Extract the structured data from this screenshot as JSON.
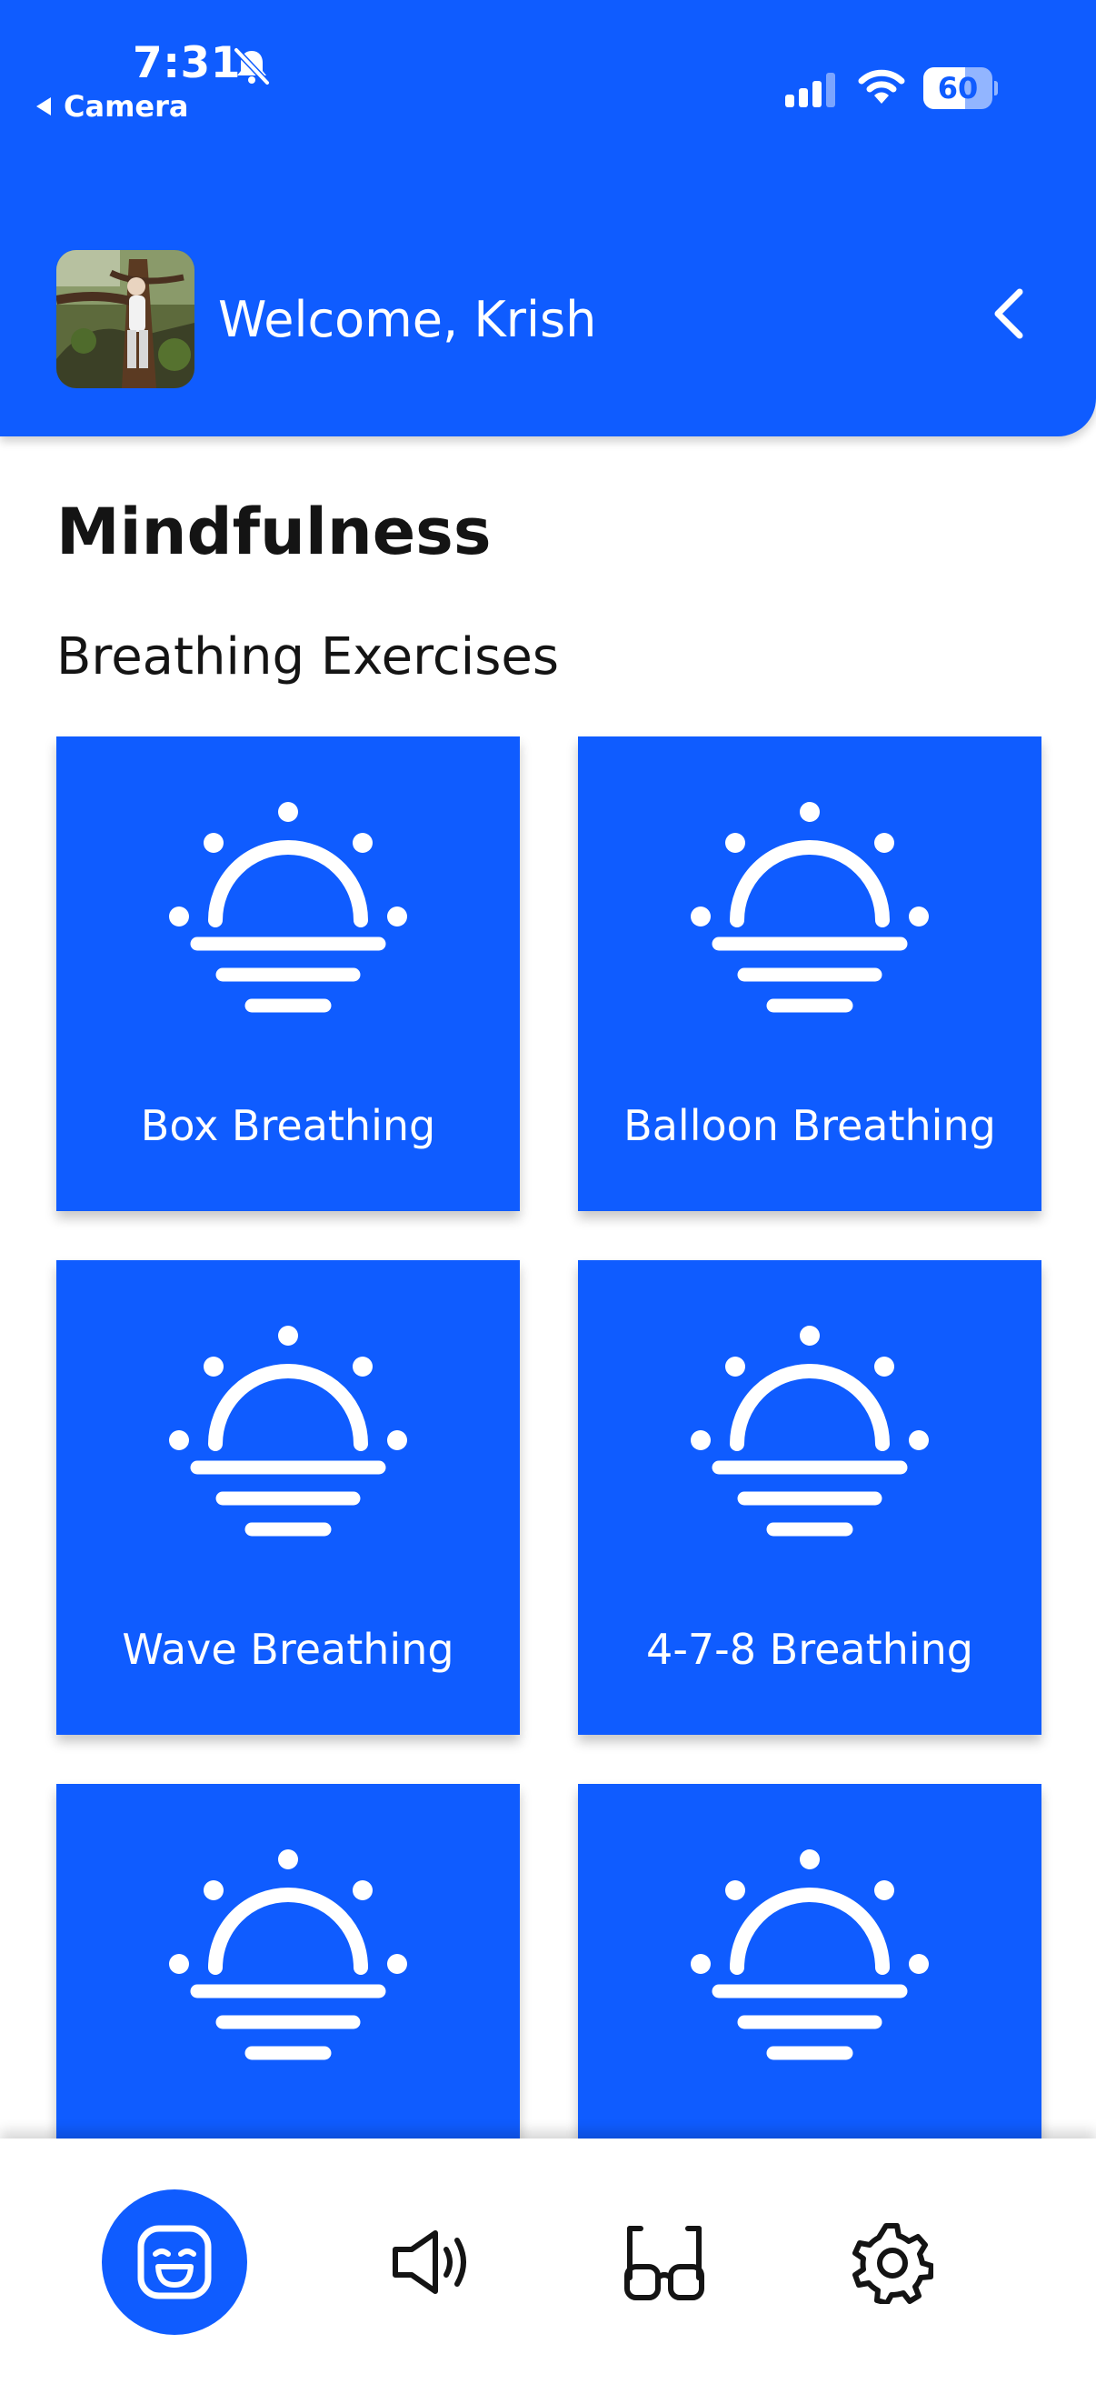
{
  "status_bar": {
    "time": "7:31",
    "back_app": "Camera",
    "battery_level": "60",
    "battery_fraction": 0.6
  },
  "header": {
    "welcome": "Welcome, Krish",
    "background_color": "#0f5cff"
  },
  "page": {
    "title": "Mindfulness",
    "section_title": "Breathing Exercises"
  },
  "exercises": [
    {
      "label": "Box Breathing",
      "icon": "sunrise-icon"
    },
    {
      "label": "Balloon Breathing",
      "icon": "sunrise-icon"
    },
    {
      "label": "Wave Breathing",
      "icon": "sunrise-icon"
    },
    {
      "label": "4-7-8 Breathing",
      "icon": "sunrise-icon"
    },
    {
      "label": "",
      "icon": "sunrise-icon"
    },
    {
      "label": "",
      "icon": "sunrise-icon"
    }
  ],
  "nav": {
    "items": [
      {
        "name": "mindfulness",
        "icon": "happy-face-icon",
        "active": true
      },
      {
        "name": "sound",
        "icon": "speaker-icon",
        "active": false
      },
      {
        "name": "reading",
        "icon": "glasses-icon",
        "active": false
      },
      {
        "name": "settings",
        "icon": "gear-icon",
        "active": false
      }
    ],
    "accent_color": "#0f5cff"
  }
}
